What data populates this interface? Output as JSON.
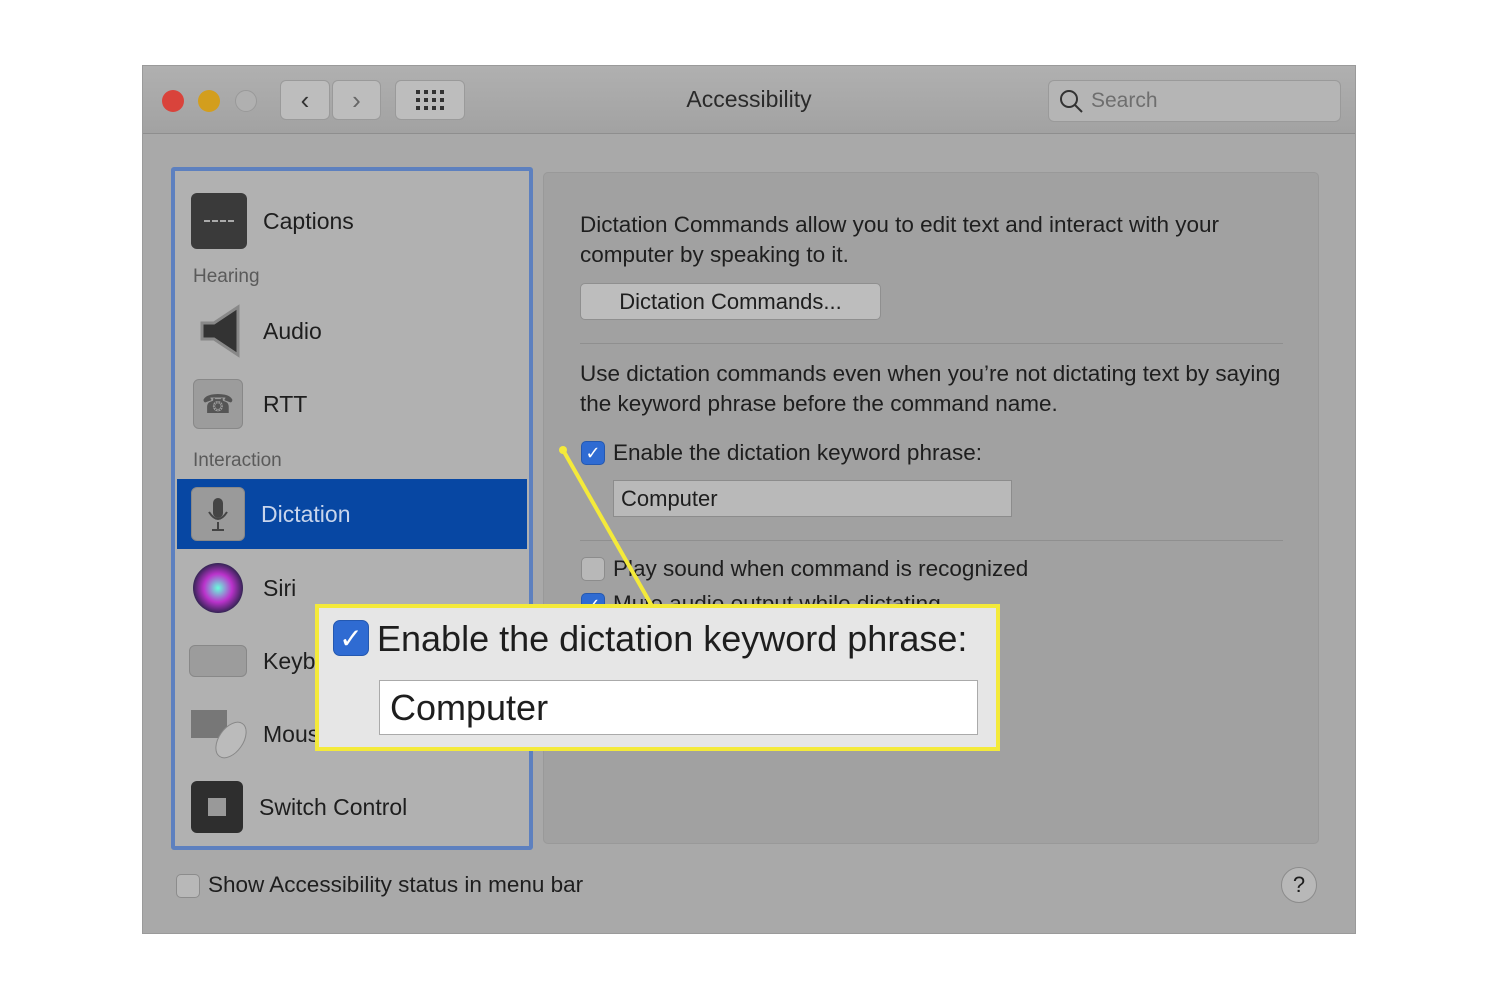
{
  "window": {
    "title": "Accessibility",
    "search_placeholder": "Search",
    "back": "‹",
    "forward": "›"
  },
  "colors": {
    "close": "#d9433b",
    "minimize": "#d39e1d",
    "zoom": "#b0b0b0",
    "selection": "#0747a3",
    "highlight": "#f4ea3a",
    "checkbox": "#2f6bd2"
  },
  "sidebar": {
    "items": [
      {
        "label": "Captions",
        "icon": "captions-icon"
      },
      {
        "section": "Hearing"
      },
      {
        "label": "Audio",
        "icon": "speaker-icon"
      },
      {
        "label": "RTT",
        "icon": "tty-phone-icon"
      },
      {
        "section": "Interaction"
      },
      {
        "label": "Dictation",
        "icon": "microphone-icon",
        "selected": true
      },
      {
        "label": "Siri",
        "icon": "siri-icon"
      },
      {
        "label": "Keyboard",
        "icon": "keyboard-icon"
      },
      {
        "label": "Mouse & Trackpad",
        "icon": "mouse-icon"
      },
      {
        "label": "Switch Control",
        "icon": "switch-control-icon"
      }
    ]
  },
  "main": {
    "intro": "Dictation Commands allow you to edit text and interact with your computer by speaking to it.",
    "commands_button": "Dictation Commands...",
    "keyword_desc": "Use dictation commands even when you’re not dictating text by saying the keyword phrase before the command name.",
    "enable_keyword": {
      "label": "Enable the dictation keyword phrase:",
      "checked": true
    },
    "keyword_value": "Computer",
    "play_sound": {
      "label": "Play sound when command is recognized",
      "checked": false
    },
    "mute_audio": {
      "label": "Mute audio output while dictating",
      "checked": true
    }
  },
  "footer": {
    "status_label": "Show Accessibility status in menu bar",
    "status_checked": false,
    "help": "?"
  },
  "callout": {
    "label": "Enable the dictation keyword phrase:",
    "value": "Computer",
    "checked": true
  }
}
